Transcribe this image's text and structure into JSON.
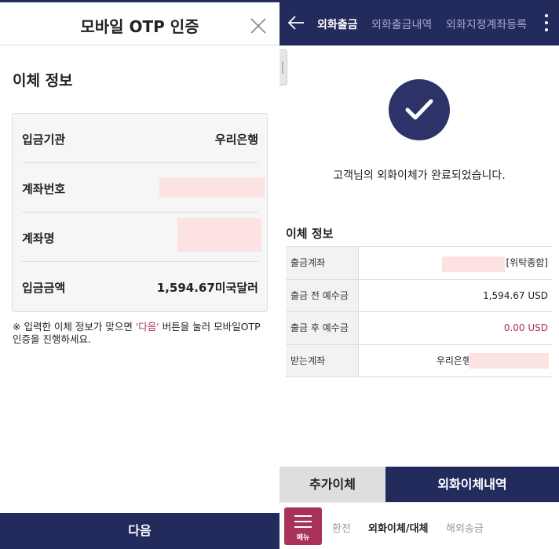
{
  "left": {
    "title": "모바일 OTP 인증",
    "section_title": "이체 정보",
    "rows": [
      {
        "label": "입금기관",
        "value": "우리은행"
      },
      {
        "label": "계좌번호",
        "value": ""
      },
      {
        "label": "계좌명",
        "value": ""
      },
      {
        "label": "입금금액",
        "value": "1,594.67미국달러"
      }
    ],
    "notice_prefix": "※ 입력한 이체 정보가 맞으면 ",
    "notice_highlight": "'다음'",
    "notice_suffix": " 버튼을 눌러 모바일OTP 인증을 진행하세요.",
    "next_label": "다음"
  },
  "right": {
    "tabs": [
      {
        "label": "외화출금",
        "active": true
      },
      {
        "label": "외화출금내역",
        "active": false
      },
      {
        "label": "외화지정계좌등록",
        "active": false
      }
    ],
    "done_message": "고객님의 외화이체가 완료되었습니다.",
    "section_title": "이체 정보",
    "rows": [
      {
        "label": "출금계좌",
        "value": "[위탁종합]"
      },
      {
        "label": "출금 전 예수금",
        "value": "1,594.67 USD"
      },
      {
        "label": "출금 후 예수금",
        "value": "0.00 USD"
      },
      {
        "label": "받는계좌",
        "value": "우리은행"
      }
    ],
    "bottom_tabs": {
      "add": "추가이체",
      "history": "외화이체내역"
    },
    "menu_label": "메뉴",
    "nav_items": [
      {
        "label": "환전",
        "active": false
      },
      {
        "label": "외화이체/대체",
        "active": true
      },
      {
        "label": "해외송금",
        "active": false
      }
    ]
  },
  "colors": {
    "primary_navy": "#232a5c",
    "accent": "#a8325a",
    "mask": "#fde2e4"
  }
}
